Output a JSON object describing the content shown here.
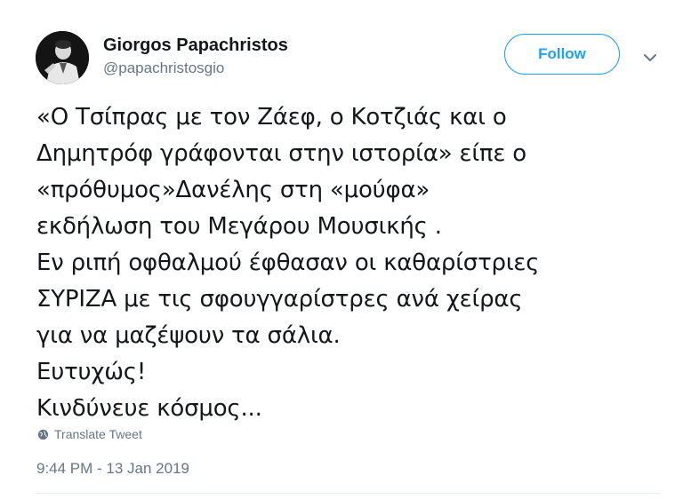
{
  "tweet": {
    "author_name": "Giorgos Papachristos",
    "author_handle": "@papachristosgio",
    "follow_label": "Follow",
    "lines": [
      "«Ο Τσίπρας με τον Ζάεφ, ο Κοτζιάς και ο",
      "Δημητρόφ γράφονται στην ιστορία» είπε ο",
      "«πρόθυμος»Δανέλης στη «μούφα»",
      "εκδήλωση του Μεγάρου Μουσικής .",
      "Εν ριπή οφθαλμού έφθασαν οι καθαρίστριες",
      "ΣΥΡΙΖΑ με τις σφουγγαρίστρες ανά χείρας",
      "για να μαζέψουν τα σάλια.",
      "Ευτυχώς!",
      "Κινδύνευε κόσμος..."
    ],
    "translate_label": "Translate Tweet",
    "timestamp": "9:44 PM - 13 Jan 2019"
  },
  "icons": {
    "caret": "chevron-down-icon",
    "translate": "globe-icon"
  },
  "colors": {
    "accent": "#1da1f2",
    "text": "#14171a",
    "secondary": "#657786",
    "divider": "#e6ecf0"
  }
}
